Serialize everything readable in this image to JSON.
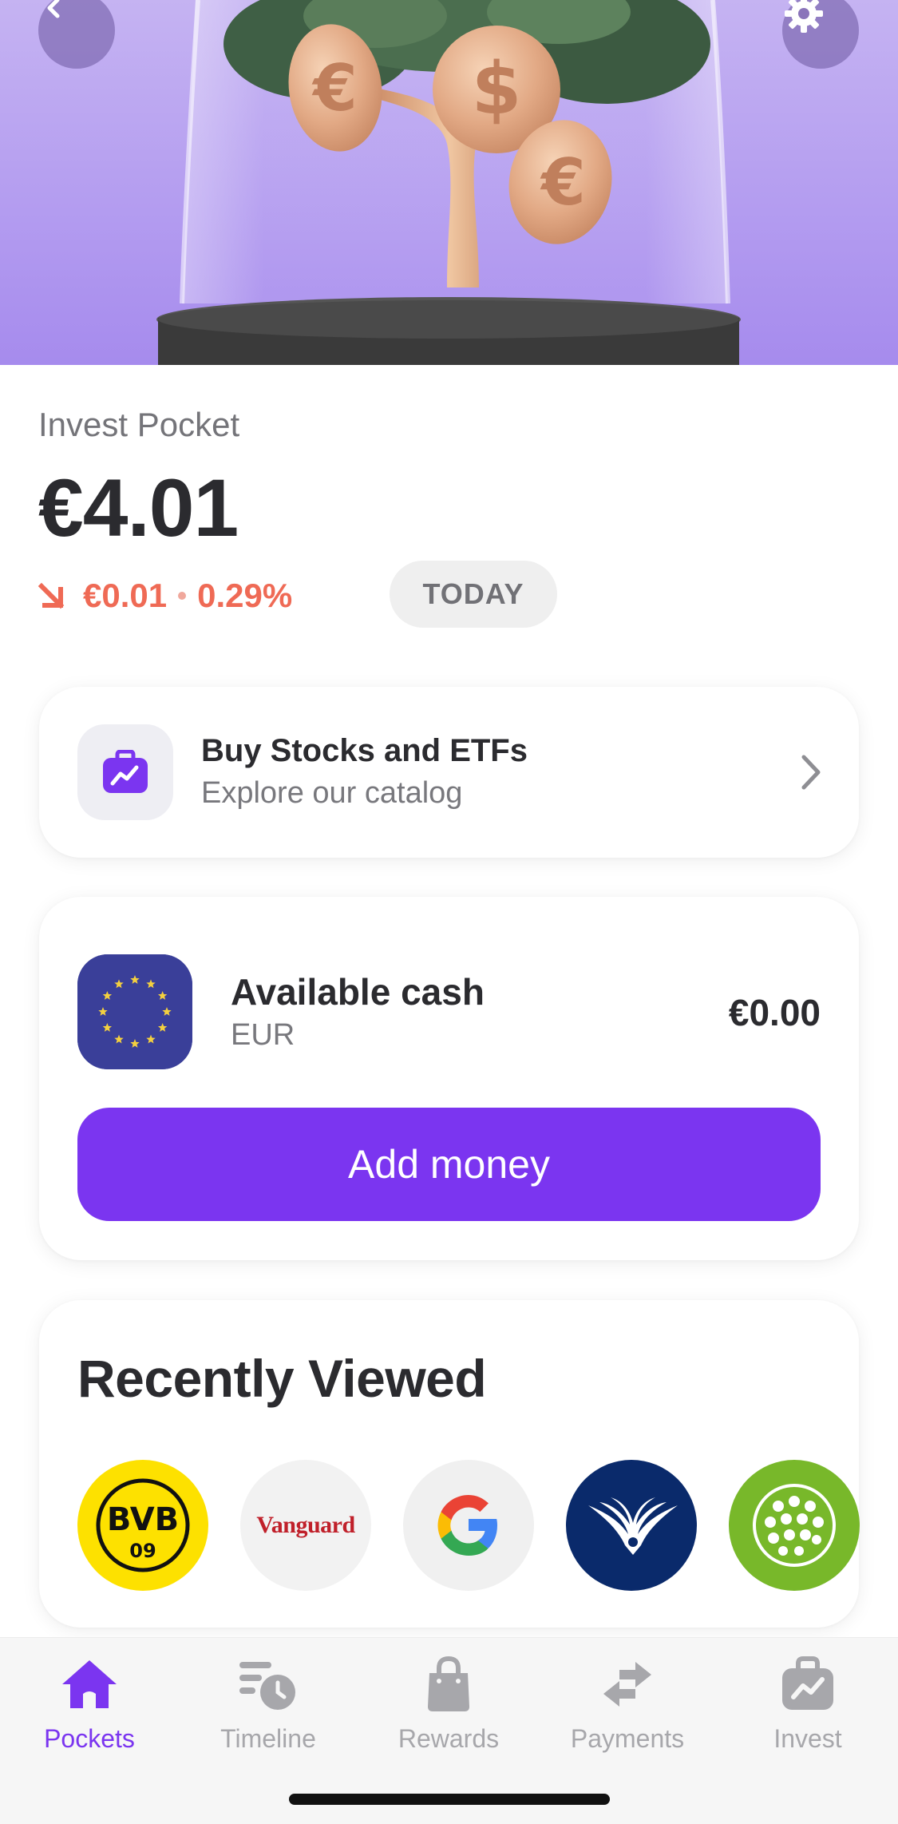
{
  "hero": {
    "back_icon": "chevron-left-icon",
    "settings_icon": "gear-icon",
    "illustration": "money-tree-under-glass-dome",
    "coin_symbols": [
      "€",
      "$",
      "€"
    ]
  },
  "pocket": {
    "label": "Invest Pocket",
    "balance": "€4.01",
    "change_amount": "€0.01",
    "change_percent": "0.29%",
    "change_direction": "down",
    "period": "TODAY",
    "negative_color": "#ef6a55"
  },
  "buy_card": {
    "title": "Buy Stocks and ETFs",
    "subtitle": "Explore our catalog",
    "icon": "briefcase-chart-icon"
  },
  "cash_card": {
    "title": "Available cash",
    "currency": "EUR",
    "amount": "€0.00",
    "flag_icon": "eu-flag-icon",
    "button_label": "Add money"
  },
  "recently_viewed": {
    "title": "Recently Viewed",
    "items": [
      {
        "name": "BVB",
        "sub": "09",
        "icon": "bvb-logo"
      },
      {
        "name": "Vanguard",
        "icon": "vanguard-logo"
      },
      {
        "name": "G",
        "icon": "google-logo"
      },
      {
        "name": "eagle",
        "icon": "eagle-logo"
      },
      {
        "name": "sphere",
        "icon": "green-sphere-logo"
      }
    ]
  },
  "tabbar": {
    "tabs": [
      {
        "label": "Pockets",
        "icon": "home-icon",
        "active": true
      },
      {
        "label": "Timeline",
        "icon": "timeline-clock-icon",
        "active": false
      },
      {
        "label": "Rewards",
        "icon": "shopping-bag-icon",
        "active": false
      },
      {
        "label": "Payments",
        "icon": "transfer-arrows-icon",
        "active": false
      },
      {
        "label": "Invest",
        "icon": "briefcase-chart-icon",
        "active": false
      }
    ]
  },
  "colors": {
    "accent": "#7b35f0",
    "hero_bg": "#b49df0",
    "text": "#2b2b2f",
    "muted": "#78787d"
  }
}
